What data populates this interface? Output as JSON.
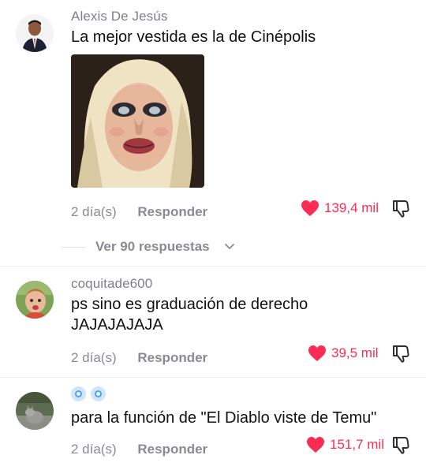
{
  "comments": [
    {
      "username": "Alexis De Jesús",
      "text": "La mejor vestida es la de Cinépolis",
      "time": "2 día(s)",
      "reply_label": "Responder",
      "likes": "139,4 mil"
    },
    {
      "username": "coquitade600",
      "text_line1": "ps sino es graduación de derecho",
      "text_line2": "JAJAJAJAJA",
      "time": "2 día(s)",
      "reply_label": "Responder",
      "likes": "39,5 mil"
    },
    {
      "username": "",
      "text": "para la función de \"El Diablo viste de Temu\"",
      "time": "2 día(s)",
      "reply_label": "Responder",
      "likes": "151,7 mil"
    }
  ],
  "view_replies": "Ver 90 respuestas",
  "colors": {
    "like": "#fe2c55",
    "muted": "#8a8b91"
  },
  "icons": [
    "heart-icon",
    "dislike-icon",
    "chevron-down-icon",
    "badge-icon"
  ]
}
